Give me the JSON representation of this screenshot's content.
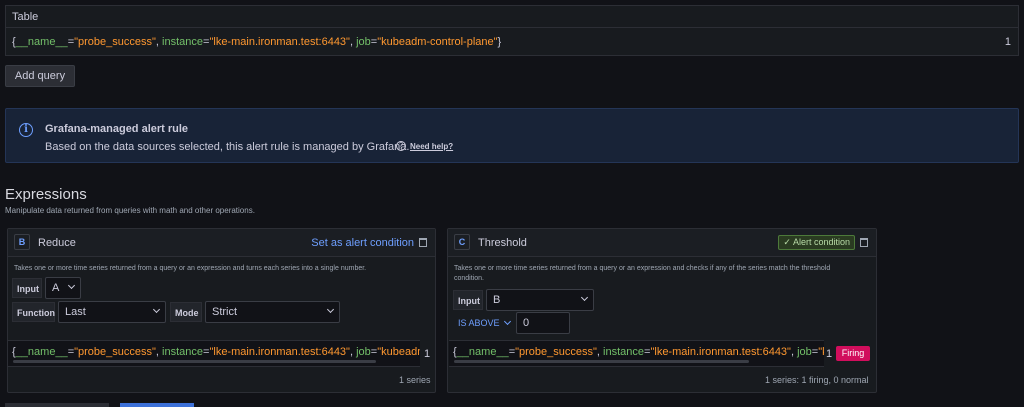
{
  "table": {
    "title": "Table",
    "row": {
      "open": "{",
      "k1": "__name__",
      "v1": "\"probe_success\"",
      "k2": "instance",
      "v2": "\"lke-main.ironman.test:6443\"",
      "k3": "job",
      "v3": "\"kubeadm-control-plane\"",
      "close": "}",
      "value": "1"
    }
  },
  "add_query_label": "Add query",
  "info": {
    "title": "Grafana-managed alert rule",
    "text": "Based on the data sources selected, this alert rule is managed by Grafana.",
    "help_label": "Need help?"
  },
  "expressions": {
    "heading": "Expressions",
    "subheading": "Manipulate data returned from queries with math and other operations."
  },
  "reduce": {
    "letter": "B",
    "title": "Reduce",
    "set_alert_label": "Set as alert condition",
    "description": "Takes one or more time series returned from a query or an expression and turns each series into a single number.",
    "input_label": "Input",
    "input_value": "A",
    "function_label": "Function",
    "function_value": "Last",
    "mode_label": "Mode",
    "mode_value": "Strict",
    "result_value": "1",
    "footer": "1 series"
  },
  "threshold": {
    "letter": "C",
    "title": "Threshold",
    "alert_condition_label": "✓ Alert condition",
    "description_line1": "Takes one or more time series returned from a query or an expression and checks if any of the series match the threshold",
    "description_line2": "condition.",
    "input_label": "Input",
    "input_value": "B",
    "operator_label": "IS ABOVE",
    "threshold_value": "0",
    "result_value": "1",
    "firing_label": "Firing",
    "footer": "1 series: 1 firing, 0 normal"
  },
  "colors": {
    "accent": "#6e9fff",
    "label_key": "#73bf69",
    "label_value": "#ff9830",
    "firing": "#d10e5c"
  }
}
